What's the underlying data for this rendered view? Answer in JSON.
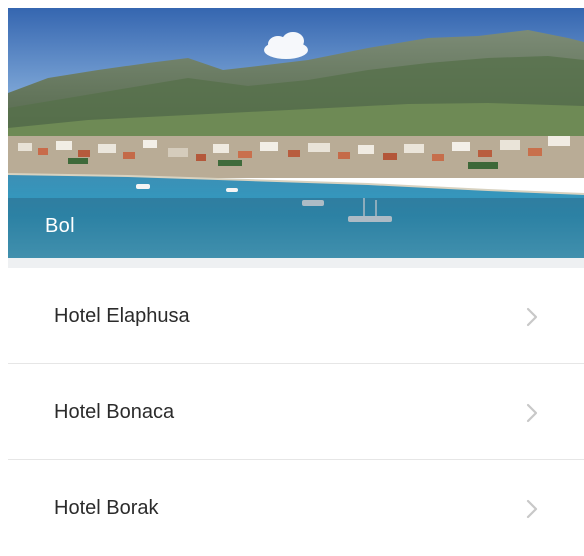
{
  "destination": {
    "name": "Bol",
    "hero_image": "bol-coastline-photo"
  },
  "hotels": [
    {
      "name": "Hotel Elaphusa"
    },
    {
      "name": "Hotel Bonaca"
    },
    {
      "name": "Hotel Borak"
    }
  ],
  "icons": {
    "row_chevron": "chevron-right-icon"
  },
  "colors": {
    "sky": "#3f6fb6",
    "sea": "#2f8fb8",
    "mountain": "#5d6f58",
    "text": "#2b2b2b",
    "chevron": "#c8c8c8",
    "divider": "#e6e6e6"
  }
}
